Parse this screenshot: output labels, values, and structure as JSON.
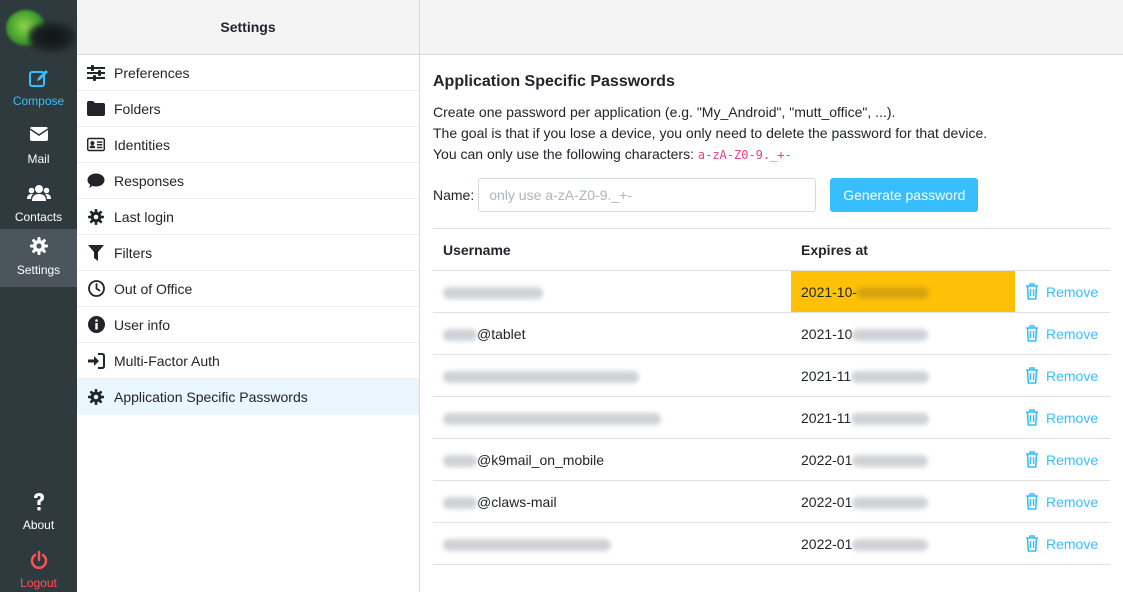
{
  "rail": {
    "compose": "Compose",
    "mail": "Mail",
    "contacts": "Contacts",
    "settings": "Settings",
    "about": "About",
    "logout": "Logout"
  },
  "nav": {
    "title": "Settings",
    "items": [
      {
        "label": "Preferences",
        "icon": "sliders-icon"
      },
      {
        "label": "Folders",
        "icon": "folder-icon"
      },
      {
        "label": "Identities",
        "icon": "id-card-icon"
      },
      {
        "label": "Responses",
        "icon": "comment-icon"
      },
      {
        "label": "Last login",
        "icon": "gear-icon"
      },
      {
        "label": "Filters",
        "icon": "filter-icon"
      },
      {
        "label": "Out of Office",
        "icon": "clock-icon"
      },
      {
        "label": "User info",
        "icon": "info-icon"
      },
      {
        "label": "Multi-Factor Auth",
        "icon": "sign-in-icon"
      },
      {
        "label": "Application Specific Passwords",
        "icon": "gear-icon"
      }
    ]
  },
  "main": {
    "title": "Application Specific Passwords",
    "line1": "Create one password per application (e.g. \"My_Android\", \"mutt_office\", ...).",
    "line2": "The goal is that if you lose a device, you only need to delete the password for that device.",
    "line3": "You can only use the following characters: ",
    "allowed_chars": "a-zA-Z0-9._+-",
    "name_label": "Name:",
    "name_placeholder": "only use a-zA-Z0-9._+-",
    "generate_label": "Generate password",
    "col_username": "Username",
    "col_expires": "Expires at",
    "remove_label": "Remove",
    "rows": [
      {
        "username": "",
        "expires": "2021-10-"
      },
      {
        "username": "@tablet",
        "expires": "2021-10"
      },
      {
        "username": "",
        "expires": "2021-11"
      },
      {
        "username": "",
        "expires": "2021-11"
      },
      {
        "username": "@k9mail_on_mobile",
        "expires": "2022-01"
      },
      {
        "username": "@claws-mail",
        "expires": "2022-01"
      },
      {
        "username": "",
        "expires": "2022-01"
      }
    ]
  },
  "colors": {
    "accent": "#37beff",
    "rail_bg": "#2f3a3f",
    "highlight": "#ffc107",
    "logout": "#ff5552"
  }
}
